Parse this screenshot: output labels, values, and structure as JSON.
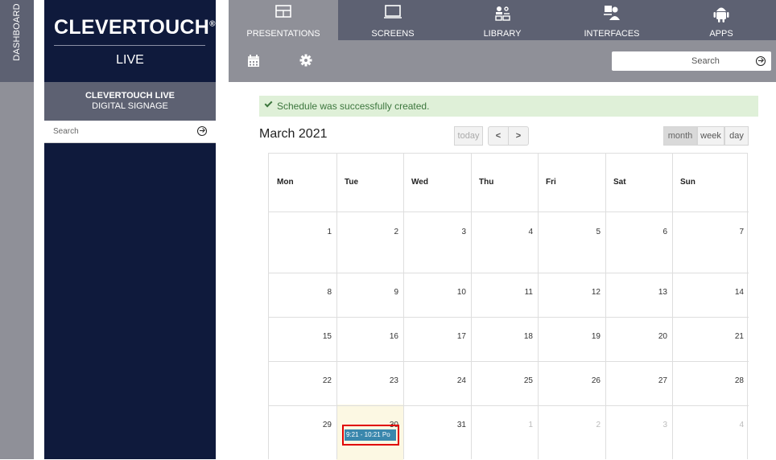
{
  "dashboard": {
    "label": "DASHBOARD"
  },
  "brand": {
    "name": "CLEVERTOUCH",
    "reg": "®",
    "sub": "LIVE"
  },
  "panel": {
    "title_line1": "CLEVERTOUCH LIVE",
    "title_line2": "DIGITAL SIGNAGE",
    "search_placeholder": "Search"
  },
  "nav": {
    "items": [
      {
        "label": "PRESENTATIONS",
        "icon": "presentation-icon",
        "active": true
      },
      {
        "label": "SCREENS",
        "icon": "monitor-icon",
        "active": false
      },
      {
        "label": "LIBRARY",
        "icon": "library-icon",
        "active": false
      },
      {
        "label": "INTERFACES",
        "icon": "interface-icon",
        "active": false
      },
      {
        "label": "APPS",
        "icon": "android-icon",
        "active": false
      }
    ]
  },
  "toolbar": {
    "search_placeholder": "Search"
  },
  "notice": {
    "text": "Schedule was successfully created."
  },
  "calendar": {
    "title": "March 2021",
    "buttons": {
      "today": "today",
      "prev": "<",
      "next": ">",
      "month": "month",
      "week": "week",
      "day": "day"
    },
    "active_view": "month",
    "weekdays": [
      "Mon",
      "Tue",
      "Wed",
      "Thu",
      "Fri",
      "Sat",
      "Sun"
    ],
    "weeks": [
      [
        "1",
        "2",
        "3",
        "4",
        "5",
        "6",
        "7"
      ],
      [
        "8",
        "9",
        "10",
        "11",
        "12",
        "13",
        "14"
      ],
      [
        "15",
        "16",
        "17",
        "18",
        "19",
        "20",
        "21"
      ],
      [
        "22",
        "23",
        "24",
        "25",
        "26",
        "27",
        "28"
      ],
      [
        "29",
        "30",
        "31",
        "1",
        "2",
        "3",
        "4"
      ]
    ],
    "event": {
      "text": "9:21 - 10:21 Po",
      "day": "30"
    }
  },
  "colors": {
    "nav_bg": "#5d6172",
    "nav_active": "#8f9098",
    "panel_bg": "#0f1a3c",
    "notice_bg": "#dff0d8",
    "event_bg": "#3a87ad",
    "today_bg": "#fcf8e3",
    "highlight": "#e00000"
  }
}
